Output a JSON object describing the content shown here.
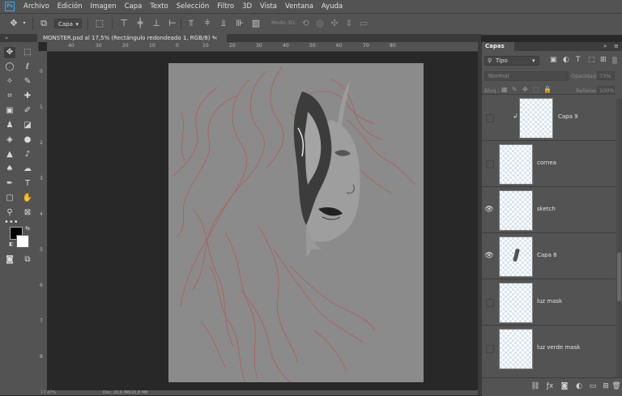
{
  "menu": [
    "Archivo",
    "Edición",
    "Imagen",
    "Capa",
    "Texto",
    "Selección",
    "Filtro",
    "3D",
    "Vista",
    "Ventana",
    "Ayuda"
  ],
  "app_logo": "Ps",
  "options": {
    "autoselect_value": "Capa",
    "mode_3d_label": "Modo 3D:"
  },
  "document_tab": {
    "title": "MONSTER.psd al 17,5% (Rectángulo redondeado 1, RGB/8) *",
    "close": "×"
  },
  "rulers": {
    "top": [
      "40",
      "30",
      "20",
      "10",
      "0",
      "10",
      "20",
      "30",
      "40",
      "50",
      "60",
      "70",
      "80"
    ],
    "left": [
      "0",
      "1",
      "2",
      "3",
      "4",
      "5",
      "6",
      "7",
      "8"
    ]
  },
  "status": {
    "zoom": "17,47%",
    "doc": "Doc: 20,8 MB/20,8 MB"
  },
  "layers_panel": {
    "tab_label": "Capas",
    "filter_value": "Tipo",
    "blend_mode": "Normal",
    "opacity_label": "Opacidad:",
    "opacity_value": "73%",
    "lock_label": "Bloq.:",
    "fill_label": "Relleno:",
    "fill_value": "100%",
    "layers": [
      {
        "name": "Capa 9",
        "visible": false,
        "clipped": true
      },
      {
        "name": "cornea",
        "visible": false
      },
      {
        "name": "sketch",
        "visible": true
      },
      {
        "name": "Capa 8",
        "visible": true
      },
      {
        "name": "luz mask",
        "visible": false
      },
      {
        "name": "luz verde mask",
        "visible": false
      }
    ]
  },
  "colors": {
    "chrome": "#535353",
    "workspace": "#282828",
    "canvas": "#8b8b8b",
    "sketch_lines": "#b8554c",
    "accent": "#31a8ff"
  }
}
